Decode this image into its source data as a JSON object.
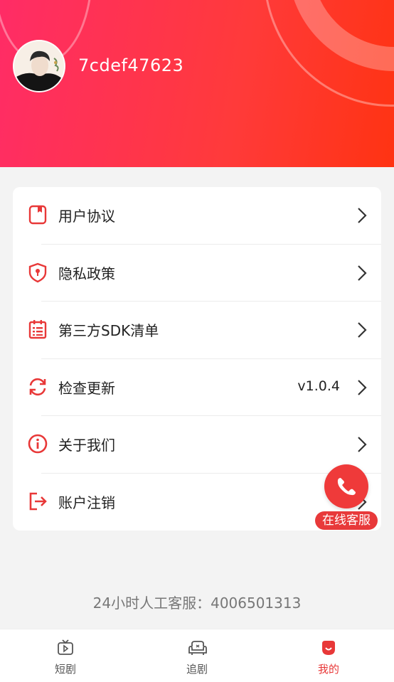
{
  "profile": {
    "username": "7cdef47623"
  },
  "menu": [
    {
      "label": "用户协议",
      "value": "",
      "icon": "document-icon"
    },
    {
      "label": "隐私政策",
      "value": "",
      "icon": "shield-lock-icon"
    },
    {
      "label": "第三方SDK清单",
      "value": "",
      "icon": "calendar-list-icon"
    },
    {
      "label": "检查更新",
      "value": "v1.0.4",
      "icon": "refresh-icon"
    },
    {
      "label": "关于我们",
      "value": "",
      "icon": "info-icon"
    },
    {
      "label": "账户注销",
      "value": "",
      "icon": "logout-icon"
    }
  ],
  "floating_service": {
    "label": "在线客服",
    "icon": "phone-icon"
  },
  "hotline": "24小时人工客服：4006501313",
  "tabs": [
    {
      "label": "短剧",
      "icon": "tv-play-icon",
      "active": false
    },
    {
      "label": "追剧",
      "icon": "sofa-icon",
      "active": false
    },
    {
      "label": "我的",
      "icon": "profile-icon",
      "active": true
    }
  ],
  "colors": {
    "accent": "#e83838",
    "header_start": "#ff2c66",
    "header_end": "#ff3312"
  }
}
